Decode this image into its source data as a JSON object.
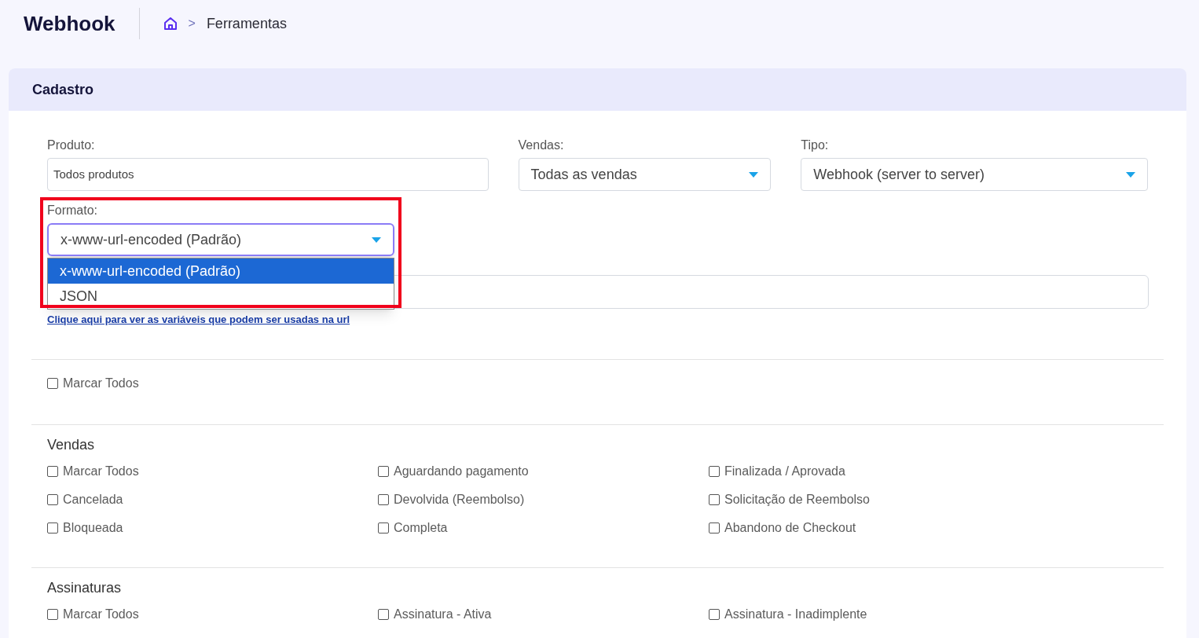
{
  "header": {
    "title": "Webhook",
    "breadcrumb_separator": ">",
    "breadcrumb": "Ferramentas"
  },
  "card": {
    "title": "Cadastro",
    "fields": [
      {
        "label": "Produto:",
        "value": "Todos produtos",
        "kind": "text"
      },
      {
        "label": "Vendas:",
        "value": "Todas as vendas",
        "kind": "select"
      },
      {
        "label": "Tipo:",
        "value": "Webhook (server to server)",
        "kind": "select"
      }
    ],
    "formato": {
      "label": "Formato:",
      "value": "x-www-url-encoded (Padrão)",
      "expanded": true,
      "highlighted": true,
      "options": [
        {
          "label": "x-www-url-encoded (Padrão)",
          "selected": true
        },
        {
          "label": "JSON",
          "selected": false
        }
      ]
    },
    "url_link": "Clique aqui para ver as variáveis que podem ser usadas na url",
    "general": [
      {
        "label": "Marcar Todos",
        "checked": false
      }
    ],
    "sections": [
      {
        "title": "Vendas",
        "items": [
          {
            "label": "Marcar Todos",
            "checked": false
          },
          {
            "label": "Aguardando pagamento",
            "checked": false
          },
          {
            "label": "Finalizada / Aprovada",
            "checked": false
          },
          {
            "label": "Cancelada",
            "checked": false
          },
          {
            "label": "Devolvida (Reembolso)",
            "checked": false
          },
          {
            "label": "Solicitação de Reembolso",
            "checked": false
          },
          {
            "label": "Bloqueada",
            "checked": false
          },
          {
            "label": "Completa",
            "checked": false
          },
          {
            "label": "Abandono de Checkout",
            "checked": false
          }
        ]
      },
      {
        "title": "Assinaturas",
        "items": [
          {
            "label": "Marcar Todos",
            "checked": false
          },
          {
            "label": "Assinatura - Ativa",
            "checked": false
          },
          {
            "label": "Assinatura - Inadimplente",
            "checked": false
          }
        ]
      }
    ]
  }
}
